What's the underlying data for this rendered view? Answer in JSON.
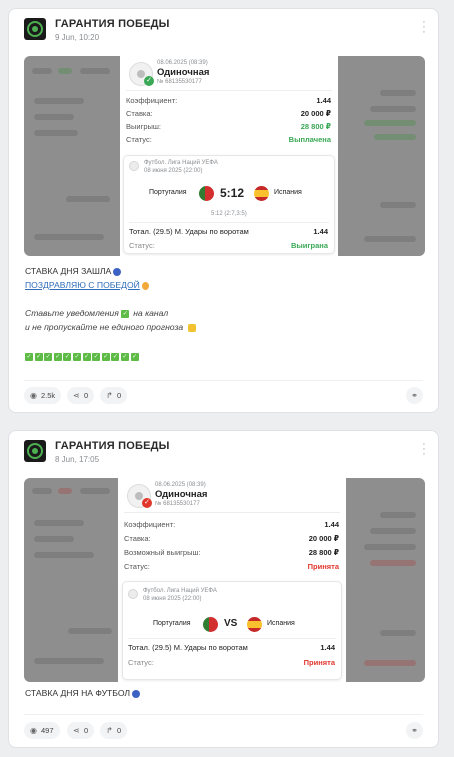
{
  "posts": [
    {
      "channel": "ГАРАНТИЯ ПОБЕДЫ",
      "date": "9 Jun, 10:20",
      "slip": {
        "datetime": "08.06.2025 (08:39)",
        "type": "Одиночная",
        "number": "№ 68135530177",
        "rows": [
          {
            "label": "Коэффициент:",
            "value": "1.44"
          },
          {
            "label": "Ставка:",
            "value": "20 000 ₽"
          },
          {
            "label": "Выигрыш:",
            "value": "28 800 ₽"
          },
          {
            "label": "Статус:",
            "value": "Выплачена"
          }
        ],
        "event": {
          "league": "Футбол. Лига Наций УЕФА",
          "date": "08 июня 2025 (22:00)",
          "home": "Португалия",
          "away": "Испания",
          "score": "5:12",
          "subscore": "5:12 (2:7,3:5)",
          "market": "Тотал. (29.5) М. Удары по воротам",
          "odds": "1.44",
          "status_label": "Статус:",
          "status": "Выиграна"
        }
      },
      "lines": {
        "l1": "СТАВКА ДНЯ ЗАШЛА",
        "l2": "ПОЗДРАВЛЯЮ С ПОБЕДОЙ",
        "l3a": "Ставьте уведомления",
        "l3b": "на канал",
        "l4": "и не пропускайте не единого прогноза"
      },
      "stats": {
        "views": "2.5k",
        "shares": "0",
        "reposts": "0"
      }
    },
    {
      "channel": "ГАРАНТИЯ ПОБЕДЫ",
      "date": "8 Jun, 17:05",
      "slip": {
        "datetime": "08.06.2025 (08:39)",
        "type": "Одиночная",
        "number": "№ 68135530177",
        "rows": [
          {
            "label": "Коэффициент:",
            "value": "1.44"
          },
          {
            "label": "Ставка:",
            "value": "20 000 ₽"
          },
          {
            "label": "Возможный выигрыш:",
            "value": "28 800 ₽"
          },
          {
            "label": "Статус:",
            "value": "Принята"
          }
        ],
        "event": {
          "league": "Футбол. Лига Наций УЕФА",
          "date": "08 июня 2025 (22:00)",
          "home": "Португалия",
          "away": "Испания",
          "score": "VS",
          "market": "Тотал. (29.5) М. Удары по воротам",
          "odds": "1.44",
          "status_label": "Статус:",
          "status": "Принята"
        }
      },
      "lines": {
        "l1": "СТАВКА ДНЯ НА ФУТБОЛ"
      },
      "stats": {
        "views": "497",
        "shares": "0",
        "reposts": "0"
      }
    }
  ],
  "colors": {
    "accent_green": "#3aa856",
    "accent_red": "#e0362b",
    "link": "#2f6db8"
  },
  "icons": {
    "views": "eye-icon",
    "shares": "share-icon",
    "reposts": "repost-icon",
    "link": "link-icon",
    "menu": "more-vertical-icon"
  }
}
